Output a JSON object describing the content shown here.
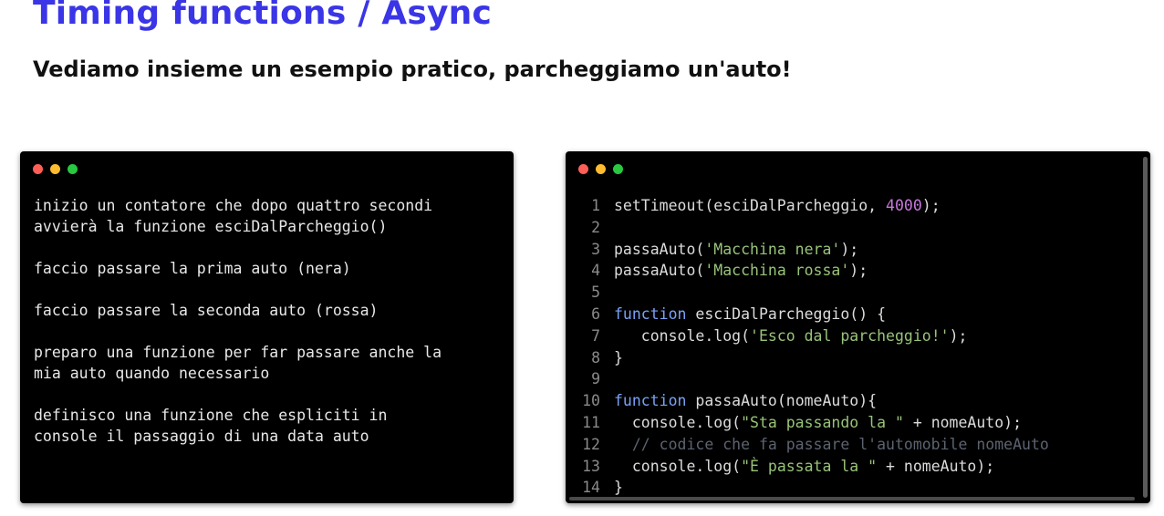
{
  "slide": {
    "title": "Timing functions / Async",
    "subtitle": "Vediamo insieme un esempio pratico, parcheggiamo un'auto!"
  },
  "colors": {
    "title": "#3a35e6",
    "window_bg": "#000000",
    "dot_red": "#ff5f57",
    "dot_yellow": "#febc2e",
    "dot_green": "#28c840",
    "keyword": "#7aa2f7",
    "string": "#98c379",
    "number": "#c678dd",
    "comment": "#5c6370"
  },
  "left_window": {
    "notes": [
      "inizio un contatore che dopo quattro secondi\navvierà la funzione esciDalParcheggio()",
      "faccio passare la prima auto (nera)",
      "faccio passare la seconda auto (rossa)",
      "preparo una funzione per far passare anche la\nmia auto quando necessario",
      "definisco una funzione che espliciti in\nconsole il passaggio di una data auto"
    ]
  },
  "right_window": {
    "code_lines": [
      {
        "n": "1",
        "tokens": [
          [
            "plain",
            "setTimeout(esciDalParcheggio, "
          ],
          [
            "num",
            "4000"
          ],
          [
            "plain",
            ");"
          ]
        ]
      },
      {
        "n": "2",
        "tokens": []
      },
      {
        "n": "3",
        "tokens": [
          [
            "plain",
            "passaAuto("
          ],
          [
            "str",
            "'Macchina nera'"
          ],
          [
            "plain",
            ");"
          ]
        ]
      },
      {
        "n": "4",
        "tokens": [
          [
            "plain",
            "passaAuto("
          ],
          [
            "str",
            "'Macchina rossa'"
          ],
          [
            "plain",
            ");"
          ]
        ]
      },
      {
        "n": "5",
        "tokens": []
      },
      {
        "n": "6",
        "tokens": [
          [
            "kw",
            "function"
          ],
          [
            "plain",
            " esciDalParcheggio() {"
          ]
        ]
      },
      {
        "n": "7",
        "tokens": [
          [
            "plain",
            "   console.log("
          ],
          [
            "str",
            "'Esco dal parcheggio!'"
          ],
          [
            "plain",
            ");"
          ]
        ]
      },
      {
        "n": "8",
        "tokens": [
          [
            "plain",
            "}"
          ]
        ]
      },
      {
        "n": "9",
        "tokens": []
      },
      {
        "n": "10",
        "tokens": [
          [
            "kw",
            "function"
          ],
          [
            "plain",
            " passaAuto(nomeAuto){"
          ]
        ]
      },
      {
        "n": "11",
        "tokens": [
          [
            "plain",
            "  console.log("
          ],
          [
            "str",
            "\"Sta passando la \""
          ],
          [
            "plain",
            " + nomeAuto);"
          ]
        ]
      },
      {
        "n": "12",
        "tokens": [
          [
            "comment",
            "  // codice che fa passare l'automobile nomeAuto"
          ]
        ]
      },
      {
        "n": "13",
        "tokens": [
          [
            "plain",
            "  console.log("
          ],
          [
            "str",
            "\"È passata la \""
          ],
          [
            "plain",
            " + nomeAuto);"
          ]
        ]
      },
      {
        "n": "14",
        "tokens": [
          [
            "plain",
            "}"
          ]
        ]
      }
    ]
  }
}
